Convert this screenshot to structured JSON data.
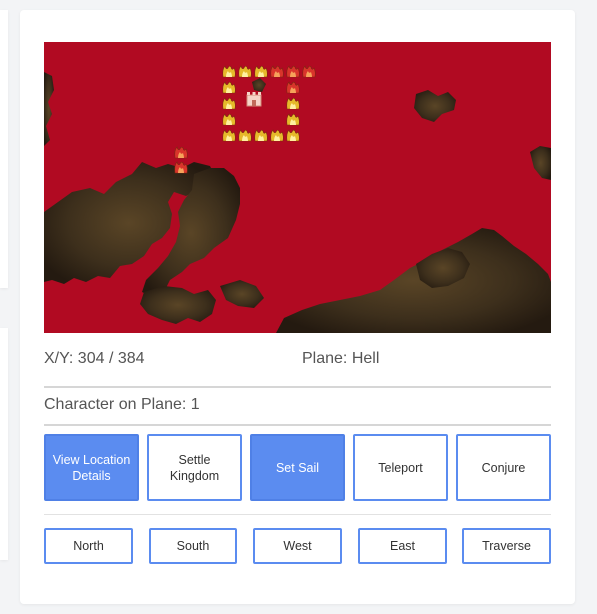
{
  "map": {
    "plane_color": "#b10a22",
    "land_color": "#3d2f1c",
    "fire_color": "#e6b92a",
    "fire_red_color": "#d9342b",
    "icons": [
      "fire-icon",
      "castle-icon"
    ]
  },
  "location": {
    "coords": "X/Y: 304 / 384",
    "plane": "Plane: Hell",
    "characters": "Character on Plane: 1"
  },
  "actions": {
    "view_location": "View Location Details",
    "settle_kingdom": "Settle Kingdom",
    "set_sail": "Set Sail",
    "teleport": "Teleport",
    "conjure": "Conjure"
  },
  "movement": {
    "north": "North",
    "south": "South",
    "west": "West",
    "east": "East",
    "traverse": "Traverse"
  }
}
